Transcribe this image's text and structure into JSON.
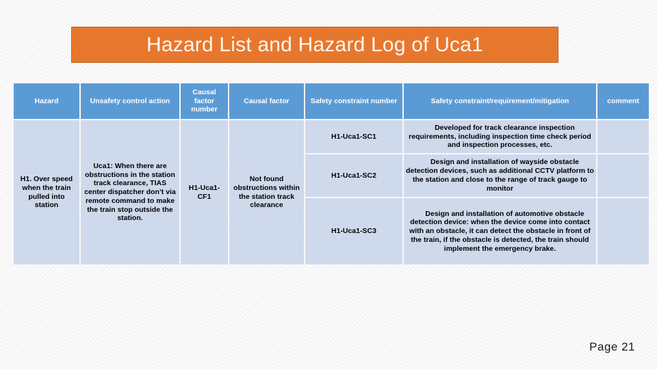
{
  "slide": {
    "title": "Hazard List and Hazard Log of Uca1",
    "page_label": "Page  21",
    "title_bg_color": "#E8772E",
    "title_border_color": "#B9651F",
    "title_text_color": "#FFF6EE",
    "header_bg_color": "#5B9BD5",
    "cell_bg_color": "#CFD9EC",
    "cell_alt_bg_color": "#E6EAF5"
  },
  "table": {
    "headers": [
      "Hazard",
      "Unsafety control action",
      "Causal factor number",
      "Causal factor",
      "Safety constraint number",
      "Safety constraint/requirement/mitigation",
      "comment"
    ],
    "hazard": "H1. Over speed when the train pulled into station",
    "unsafety_control_action": "Uca1: When there are obstructions in the station track clearance, TIAS  center dispatcher don’t via remote command to make the train stop outside the station.",
    "causal_factor_number": "H1-Uca1-CF1",
    "causal_factor": "Not found obstructions within the station track clearance",
    "rows": [
      {
        "safety_constraint_number": "H1-Uca1-SC1",
        "mitigation": "Developed for track clearance inspection requirements, including inspection time check period and inspection processes, etc.",
        "comment": ""
      },
      {
        "safety_constraint_number": "H1-Uca1-SC2",
        "mitigation": "Design and installation of wayside obstacle detection devices, such as additional CCTV platform to the station and close to the range of track gauge to monitor",
        "comment": ""
      },
      {
        "safety_constraint_number": "H1-Uca1-SC3",
        "mitigation": "Design and installation of automotive obstacle detection device: when the device come into contact with an obstacle, it can detect the obstacle in front of the train, if the obstacle is detected, the train should implement the emergency brake.",
        "comment": ""
      }
    ]
  }
}
